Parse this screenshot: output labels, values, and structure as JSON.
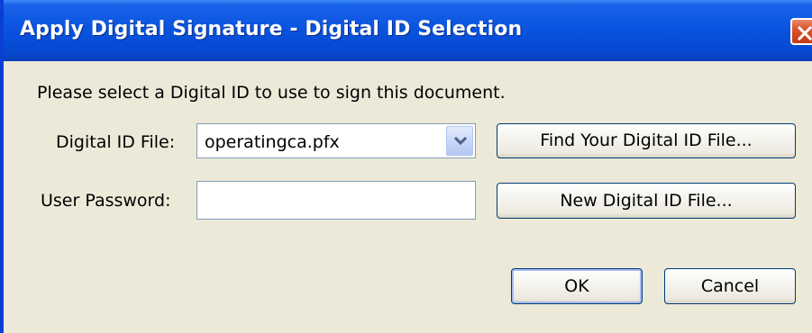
{
  "window": {
    "title": "Apply Digital Signature - Digital ID Selection",
    "close_icon": "close-x-icon"
  },
  "dialog": {
    "instruction": "Please select a Digital ID to use to sign this document.",
    "digital_id_file_label": "Digital ID File:",
    "digital_id_file_value": "operatingca.pfx",
    "dropdown_icon": "chevron-down-icon",
    "user_password_label": "User Password:",
    "user_password_value": ""
  },
  "buttons": {
    "find_label": "Find Your Digital ID File...",
    "new_label": "New Digital ID File...",
    "ok_label": "OK",
    "cancel_label": "Cancel"
  },
  "colors": {
    "titlebar": "#0a54e0",
    "dialog_background": "#ece9d8",
    "close_button": "#d9532d",
    "button_border": "#003c74"
  }
}
